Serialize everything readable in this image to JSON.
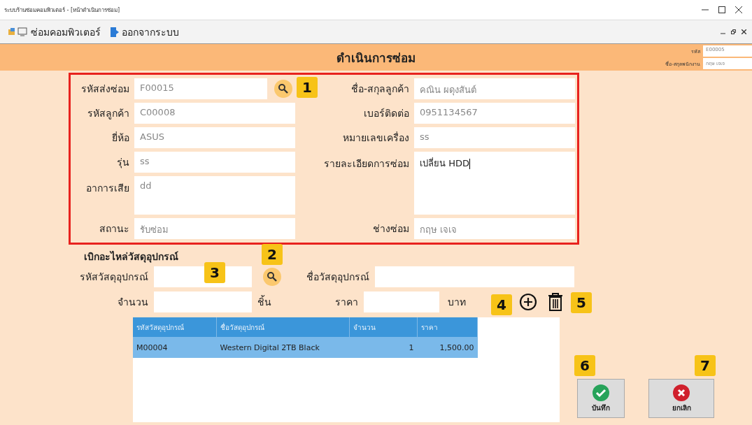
{
  "window": {
    "title": "ระบบร้านซ่อมคอมพิวเตอร์ - [หน้าดำเนินการซ่อม]"
  },
  "menu": [
    {
      "label": "ซ่อมคอมพิวเตอร์"
    },
    {
      "label": "ออกจากระบบ"
    }
  ],
  "header": {
    "title": "ดำเนินการซ่อม",
    "employee_id_label": "รหัส",
    "employee_id": "E00005",
    "employee_name_label": "ชื่อ-สกุลพนักงาน",
    "employee_name": "กฤษ เจเจ"
  },
  "repair_form": {
    "left": [
      {
        "label": "รหัสส่งซ่อม",
        "value": "F00015",
        "kind": "lookup",
        "callout": "1"
      },
      {
        "label": "รหัสลูกค้า",
        "value": "C00008",
        "kind": "text"
      },
      {
        "label": "ยี่ห้อ",
        "value": "ASUS",
        "kind": "text"
      },
      {
        "label": "รุ่น",
        "value": "ss",
        "kind": "text"
      },
      {
        "label": "อาการเสีย",
        "value": "dd",
        "kind": "multiline",
        "focused": false
      },
      {
        "label": "สถานะ",
        "value": "รับซ่อม",
        "kind": "text"
      }
    ],
    "right": [
      {
        "label": "ชื่อ-สกุลลูกค้า",
        "value": "คณิน ผดุงสันต์",
        "kind": "text"
      },
      {
        "label": "เบอร์ติดต่อ",
        "value": "0951134567",
        "kind": "text"
      },
      {
        "label": "หมายเลขเครื่อง",
        "value": "ss",
        "kind": "text"
      },
      {
        "label": "รายละเอียดการซ่อม",
        "value": "เปลี่ยน HDD",
        "kind": "multiline",
        "focused": true
      },
      {
        "label": "ช่างซ่อม",
        "value": "กฤษ เจเจ",
        "kind": "text"
      }
    ]
  },
  "parts": {
    "title": "เบิกอะไหล่วัสดุอุปกรณ์",
    "code_label": "รหัสวัสดุอุปกรณ์",
    "code_callout": "3",
    "search_callout": "2",
    "name_label": "ชื่อวัสดุอุปกรณ์",
    "quantity_label": "จำนวน",
    "quantity_unit": "ชิ้น",
    "price_label": "ราคา",
    "price_unit": "บาท",
    "add_callout": "4",
    "delete_callout": "5"
  },
  "table": {
    "columns": [
      "รหัสวัสดุอุปกรณ์",
      "ชื่อวัสดุอุปกรณ์",
      "จำนวน",
      "ราคา"
    ],
    "rows": [
      {
        "cells": [
          "M00004",
          "Western Digital 2TB Black",
          "1",
          "1,500.00"
        ],
        "selected": true
      }
    ]
  },
  "buttons": [
    {
      "label": "บันทึก",
      "kind": "save",
      "callout": "6"
    },
    {
      "label": "ยกเลิก",
      "kind": "cancel",
      "callout": "7"
    }
  ]
}
